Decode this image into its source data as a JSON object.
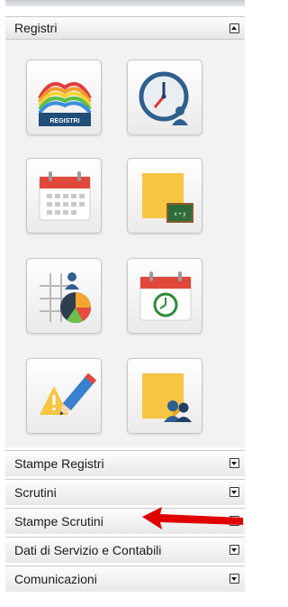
{
  "panel": {
    "header": {
      "title": "Registri",
      "toggle_icon": "collapse-up-icon"
    },
    "tiles": [
      {
        "icon": "registri-book-icon",
        "caption": "REGISTRI"
      },
      {
        "icon": "clock-user-icon"
      },
      {
        "icon": "calendar-grid-icon"
      },
      {
        "icon": "sticky-note-chalkboard-icon",
        "caption": "x + y"
      },
      {
        "icon": "grid-pie-chart-user-icon"
      },
      {
        "icon": "calendar-clock-icon"
      },
      {
        "icon": "warning-pencil-icon"
      },
      {
        "icon": "sticky-note-users-icon"
      }
    ],
    "sections": [
      {
        "label": "Stampe Registri",
        "toggle_icon": "expand-down-icon"
      },
      {
        "label": "Scrutini",
        "toggle_icon": "expand-down-icon"
      },
      {
        "label": "Stampe Scrutini",
        "toggle_icon": "expand-down-icon"
      },
      {
        "label": "Dati di Servizio e Contabili",
        "toggle_icon": "expand-down-icon"
      },
      {
        "label": "Comunicazioni",
        "toggle_icon": "expand-down-icon"
      }
    ]
  },
  "annotation": {
    "icon": "red-arrow-left-icon",
    "color": "#e00000"
  }
}
